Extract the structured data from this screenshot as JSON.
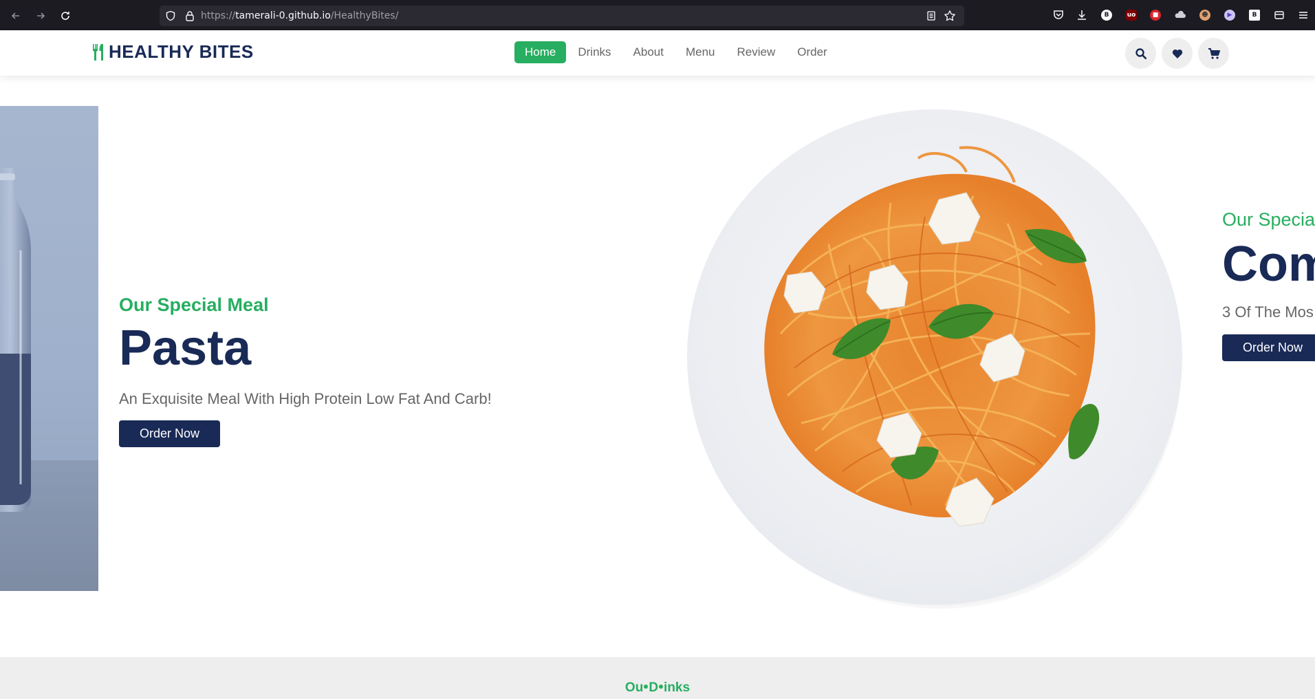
{
  "browser": {
    "url_prefix": "https://",
    "url_host": "tamerali-0.github.io",
    "url_path": "/HealthyBites/"
  },
  "header": {
    "logo_text": "HEALTHY BITES",
    "nav": [
      {
        "label": "Home",
        "active": true
      },
      {
        "label": "Drinks",
        "active": false
      },
      {
        "label": "About",
        "active": false
      },
      {
        "label": "Menu",
        "active": false
      },
      {
        "label": "Review",
        "active": false
      },
      {
        "label": "Order",
        "active": false
      }
    ],
    "icons": [
      "search-icon",
      "heart-icon",
      "cart-icon"
    ]
  },
  "hero": {
    "current": {
      "subtitle": "Our Special Meal",
      "title": "Pasta",
      "description": "An Exquisite Meal With High Protein Low Fat And Carb!",
      "button": "Order Now"
    },
    "next": {
      "subtitle": "Our Special",
      "title": "Com",
      "description": "3 Of The Mos",
      "button": "Order Now"
    }
  },
  "drinks": {
    "heading_part1": "Ou",
    "heading_part2": "D",
    "heading_part3": "inks"
  },
  "colors": {
    "accent": "#27ae60",
    "navy": "#192a56",
    "text": "#666666"
  }
}
